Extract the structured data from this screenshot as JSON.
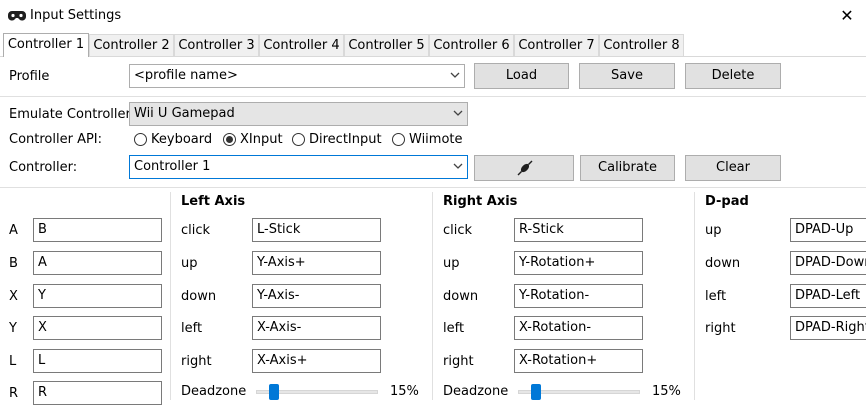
{
  "window": {
    "title": "Input Settings",
    "close_glyph": "✕",
    "app_icon": "gamepad-icon"
  },
  "tabs": [
    "Controller 1",
    "Controller 2",
    "Controller 3",
    "Controller 4",
    "Controller 5",
    "Controller 6",
    "Controller 7",
    "Controller 8"
  ],
  "active_tab": "Controller 1",
  "profile": {
    "label": "Profile",
    "value": "<profile name>",
    "load": "Load",
    "save": "Save",
    "delete": "Delete"
  },
  "emulate": {
    "label": "Emulate Controller",
    "value": "Wii U Gamepad"
  },
  "api": {
    "label": "Controller API:",
    "options": [
      "Keyboard",
      "XInput",
      "DirectInput",
      "Wiimote"
    ],
    "selected": "XInput"
  },
  "controller": {
    "label": "Controller:",
    "value": "Controller 1",
    "connect_icon": "plug-icon",
    "calibrate": "Calibrate",
    "clear": "Clear"
  },
  "buttons": [
    {
      "name": "A",
      "value": "B"
    },
    {
      "name": "B",
      "value": "A"
    },
    {
      "name": "X",
      "value": "Y"
    },
    {
      "name": "Y",
      "value": "X"
    },
    {
      "name": "L",
      "value": "L"
    },
    {
      "name": "R",
      "value": "R"
    }
  ],
  "left_axis": {
    "title": "Left Axis",
    "rows": [
      {
        "name": "click",
        "value": "L-Stick"
      },
      {
        "name": "up",
        "value": "Y-Axis+"
      },
      {
        "name": "down",
        "value": "Y-Axis-"
      },
      {
        "name": "left",
        "value": "X-Axis-"
      },
      {
        "name": "right",
        "value": "X-Axis+"
      }
    ],
    "deadzone_label": "Deadzone",
    "deadzone_value": "15%",
    "deadzone_fraction": 0.15
  },
  "right_axis": {
    "title": "Right Axis",
    "rows": [
      {
        "name": "click",
        "value": "R-Stick"
      },
      {
        "name": "up",
        "value": "Y-Rotation+"
      },
      {
        "name": "down",
        "value": "Y-Rotation-"
      },
      {
        "name": "left",
        "value": "X-Rotation-"
      },
      {
        "name": "right",
        "value": "X-Rotation+"
      }
    ],
    "deadzone_label": "Deadzone",
    "deadzone_value": "15%",
    "deadzone_fraction": 0.15
  },
  "dpad": {
    "title": "D-pad",
    "rows": [
      {
        "name": "up",
        "value": "DPAD-Up"
      },
      {
        "name": "down",
        "value": "DPAD-Down"
      },
      {
        "name": "left",
        "value": "DPAD-Left"
      },
      {
        "name": "right",
        "value": "DPAD-Right"
      }
    ]
  },
  "colors": {
    "accent": "#0078d7",
    "button_face": "#e1e1e1",
    "border": "#adadad"
  }
}
